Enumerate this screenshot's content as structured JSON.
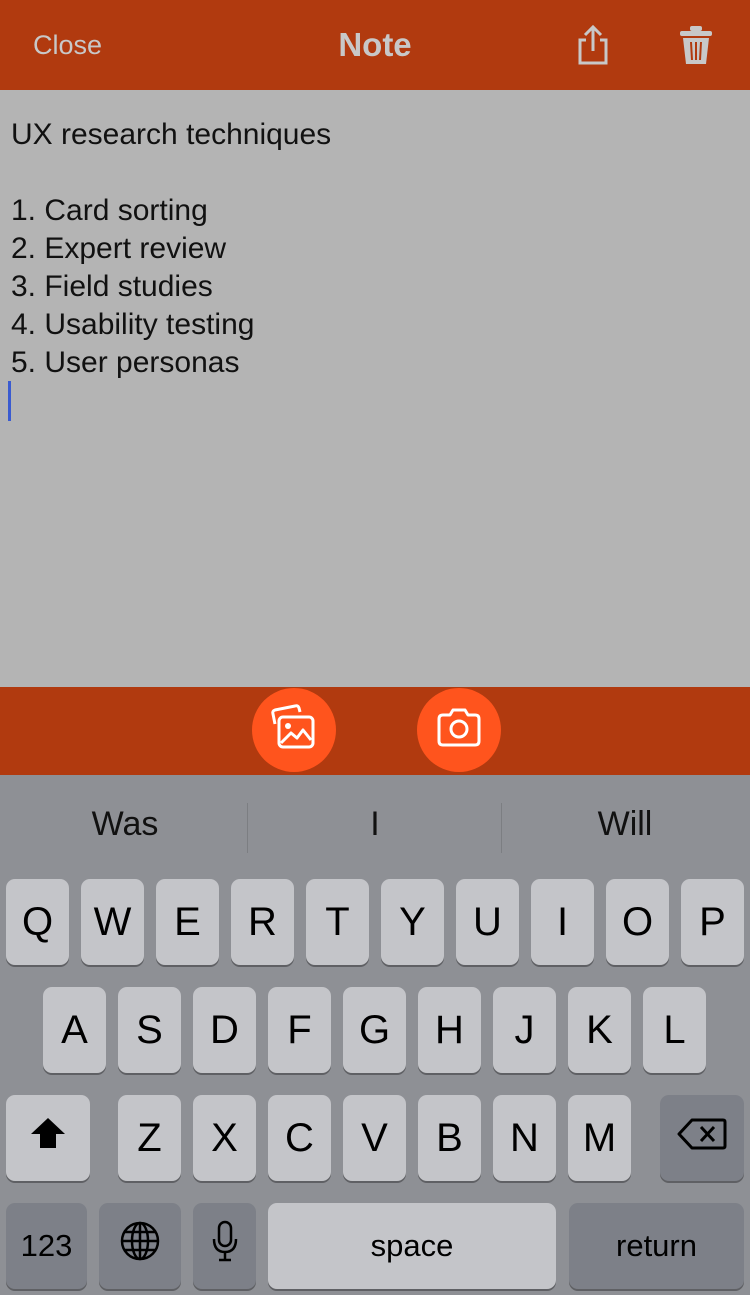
{
  "header": {
    "close_label": "Close",
    "title": "Note",
    "share_icon": "share-icon",
    "trash_icon": "trash-icon"
  },
  "note": {
    "lines": [
      "UX research techniques",
      "",
      "1. Card sorting",
      "2. Expert review",
      "3. Field studies",
      "4. Usability testing",
      "5. User personas"
    ]
  },
  "attachments": {
    "photo_icon": "photo-library-icon",
    "camera_icon": "camera-icon"
  },
  "keyboard": {
    "suggestions": [
      "Was",
      "I",
      "Will"
    ],
    "row1": [
      "Q",
      "W",
      "E",
      "R",
      "T",
      "Y",
      "U",
      "I",
      "O",
      "P"
    ],
    "row2": [
      "A",
      "S",
      "D",
      "F",
      "G",
      "H",
      "J",
      "K",
      "L"
    ],
    "row3": [
      "Z",
      "X",
      "C",
      "V",
      "B",
      "N",
      "M"
    ],
    "numbers_label": "123",
    "space_label": "space",
    "return_label": "return"
  },
  "colors": {
    "header_bg": "#b13a0f",
    "accent": "#ff541d",
    "note_bg": "#b4b4b4",
    "keyboard_bg": "#8e9095"
  }
}
